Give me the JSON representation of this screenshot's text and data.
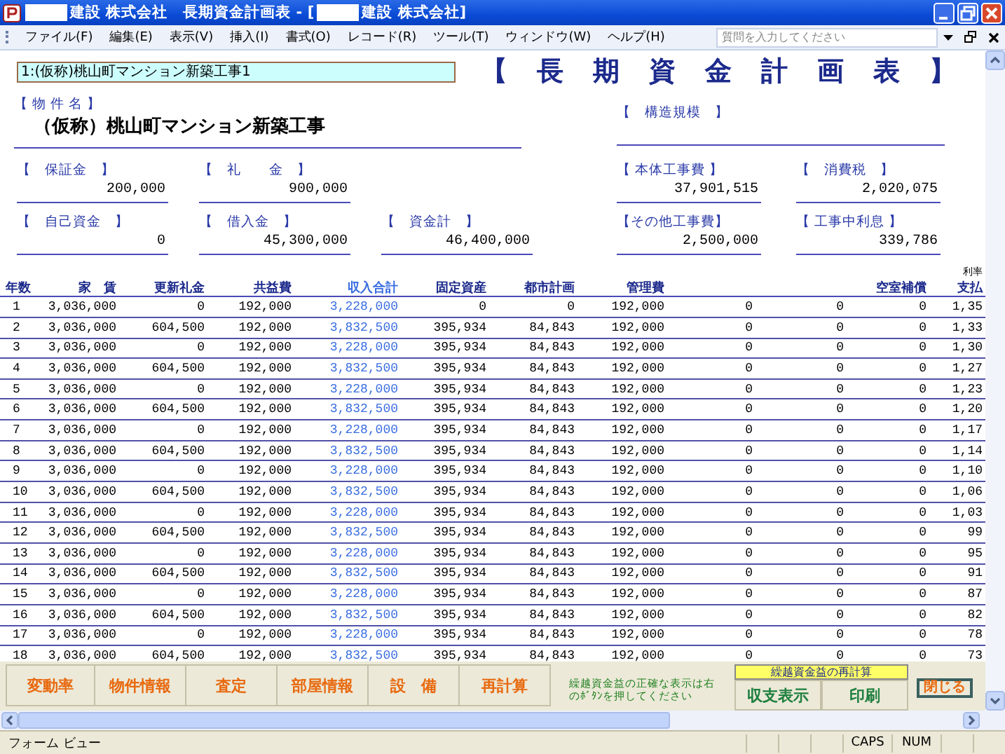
{
  "window": {
    "title_segments": [
      "建設 株式会社　長期資金計画表 - [",
      "建設 株式会社]"
    ]
  },
  "menu": [
    "ファイル(F)",
    "編集(E)",
    "表示(V)",
    "挿入(I)",
    "書式(O)",
    "レコード(R)",
    "ツール(T)",
    "ウィンドウ(W)",
    "ヘルプ(H)"
  ],
  "help_search": {
    "placeholder": "質問を入力してください"
  },
  "record_selector": {
    "value": "1:(仮称)桃山町マンション新築工事1"
  },
  "heading": "【長期資金計画表】",
  "property": {
    "label": "【 物 件 名 】",
    "value": "（仮称）桃山町マンション新築工事"
  },
  "structure": {
    "label": "【　構造規模　】"
  },
  "fields": {
    "left": [
      [
        {
          "label": "【　保証金　】",
          "value": "200,000"
        },
        {
          "label": "【　礼　　金　】",
          "value": "900,000"
        }
      ],
      [
        {
          "label": "【　自己資金　】",
          "value": "0"
        },
        {
          "label": "【　借入金　】",
          "value": "45,300,000"
        },
        {
          "label": "【　資金計　】",
          "value": "46,400,000"
        }
      ]
    ],
    "right": [
      [
        {
          "label": "【 本体工事費 】",
          "value": "37,901,515"
        },
        {
          "label": "【　消費税　】",
          "value": "2,020,075"
        }
      ],
      [
        {
          "label": "【その他工事費】",
          "value": "2,500,000"
        },
        {
          "label": "【 工事中利息 】",
          "value": "339,786"
        }
      ]
    ]
  },
  "table": {
    "columns": [
      {
        "label": "年数",
        "highlight": false
      },
      {
        "label": "家　賃",
        "highlight": false
      },
      {
        "label": "更新礼金",
        "highlight": false
      },
      {
        "label": "共益費",
        "highlight": false
      },
      {
        "label": "収入合計",
        "highlight": true
      },
      {
        "label": "固定資産",
        "highlight": false
      },
      {
        "label": "都市計画",
        "highlight": false
      },
      {
        "label": "管理費",
        "highlight": false
      },
      {},
      {},
      {
        "label": "空室補償",
        "highlight": false
      },
      {
        "label": "支払",
        "note": "利率",
        "highlight": false
      }
    ],
    "rows": [
      [
        "1",
        "3,036,000",
        "0",
        "192,000",
        "3,228,000",
        "0",
        "0",
        "192,000",
        "0",
        "0",
        "0",
        "1,35"
      ],
      [
        "2",
        "3,036,000",
        "604,500",
        "192,000",
        "3,832,500",
        "395,934",
        "84,843",
        "192,000",
        "0",
        "0",
        "0",
        "1,33"
      ],
      [
        "3",
        "3,036,000",
        "0",
        "192,000",
        "3,228,000",
        "395,934",
        "84,843",
        "192,000",
        "0",
        "0",
        "0",
        "1,30"
      ],
      [
        "4",
        "3,036,000",
        "604,500",
        "192,000",
        "3,832,500",
        "395,934",
        "84,843",
        "192,000",
        "0",
        "0",
        "0",
        "1,27"
      ],
      [
        "5",
        "3,036,000",
        "0",
        "192,000",
        "3,228,000",
        "395,934",
        "84,843",
        "192,000",
        "0",
        "0",
        "0",
        "1,23"
      ],
      [
        "6",
        "3,036,000",
        "604,500",
        "192,000",
        "3,832,500",
        "395,934",
        "84,843",
        "192,000",
        "0",
        "0",
        "0",
        "1,20"
      ],
      [
        "7",
        "3,036,000",
        "0",
        "192,000",
        "3,228,000",
        "395,934",
        "84,843",
        "192,000",
        "0",
        "0",
        "0",
        "1,17"
      ],
      [
        "8",
        "3,036,000",
        "604,500",
        "192,000",
        "3,832,500",
        "395,934",
        "84,843",
        "192,000",
        "0",
        "0",
        "0",
        "1,14"
      ],
      [
        "9",
        "3,036,000",
        "0",
        "192,000",
        "3,228,000",
        "395,934",
        "84,843",
        "192,000",
        "0",
        "0",
        "0",
        "1,10"
      ],
      [
        "10",
        "3,036,000",
        "604,500",
        "192,000",
        "3,832,500",
        "395,934",
        "84,843",
        "192,000",
        "0",
        "0",
        "0",
        "1,06"
      ],
      [
        "11",
        "3,036,000",
        "0",
        "192,000",
        "3,228,000",
        "395,934",
        "84,843",
        "192,000",
        "0",
        "0",
        "0",
        "1,03"
      ],
      [
        "12",
        "3,036,000",
        "604,500",
        "192,000",
        "3,832,500",
        "395,934",
        "84,843",
        "192,000",
        "0",
        "0",
        "0",
        "99"
      ],
      [
        "13",
        "3,036,000",
        "0",
        "192,000",
        "3,228,000",
        "395,934",
        "84,843",
        "192,000",
        "0",
        "0",
        "0",
        "95"
      ],
      [
        "14",
        "3,036,000",
        "604,500",
        "192,000",
        "3,832,500",
        "395,934",
        "84,843",
        "192,000",
        "0",
        "0",
        "0",
        "91"
      ],
      [
        "15",
        "3,036,000",
        "0",
        "192,000",
        "3,228,000",
        "395,934",
        "84,843",
        "192,000",
        "0",
        "0",
        "0",
        "87"
      ],
      [
        "16",
        "3,036,000",
        "604,500",
        "192,000",
        "3,832,500",
        "395,934",
        "84,843",
        "192,000",
        "0",
        "0",
        "0",
        "82"
      ],
      [
        "17",
        "3,036,000",
        "0",
        "192,000",
        "3,228,000",
        "395,934",
        "84,843",
        "192,000",
        "0",
        "0",
        "0",
        "78"
      ],
      [
        "18",
        "3,036,000",
        "604,500",
        "192,000",
        "3,832,500",
        "395,934",
        "84,843",
        "192,000",
        "0",
        "0",
        "0",
        "73"
      ]
    ]
  },
  "buttons": [
    "変動率",
    "物件情報",
    "査定",
    "部屋情報",
    "設　備",
    "再計算"
  ],
  "recalc_note": "繰越資金益の正確な表示は右のﾎﾞﾀﾝを押してください",
  "recalc_label": "繰越資金益の再計算",
  "recalc_buttons": [
    "収支表示",
    "印刷"
  ],
  "close_button": "閉じる",
  "status_bar": {
    "mode": "フォーム ビュー",
    "indicators": [
      "CAPS",
      "NUM"
    ]
  }
}
